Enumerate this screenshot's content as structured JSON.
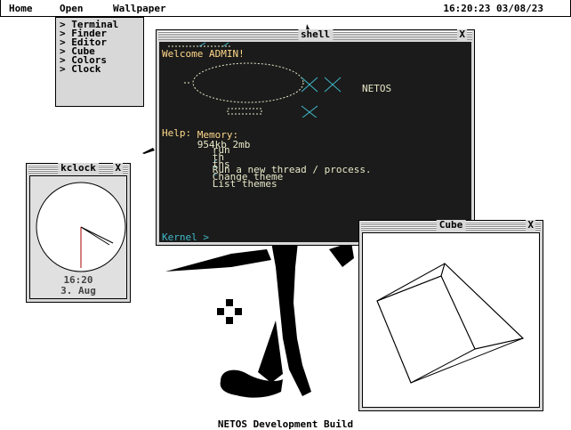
{
  "menubar": {
    "home": "Home",
    "open": "Open",
    "wallpaper": "Wallpaper",
    "clock": "16:20:23 03/08/23"
  },
  "dropdown": {
    "items": [
      {
        "label": "> Terminal"
      },
      {
        "label": "> Finder"
      },
      {
        "label": "> Editor"
      },
      {
        "label": "> Cube"
      },
      {
        "label": "> Colors"
      },
      {
        "label": "> Clock"
      }
    ]
  },
  "shell": {
    "title": "shell",
    "close": "X",
    "welcome": "Welcome ADMIN!",
    "os_name": "NETOS",
    "memory_label": "Memory:",
    "memory_value": "954kb 2mb",
    "help_label": "Help:",
    "help": [
      {
        "cmd": "run",
        "sep": "-",
        "desc": "Run a new thread / process."
      },
      {
        "cmd": "th",
        "sep": "-",
        "desc": "Change theme"
      },
      {
        "cmd": "ths",
        "sep": "-",
        "desc": "List themes"
      }
    ],
    "prompt": "Kernel >"
  },
  "kclock": {
    "title": "kclock",
    "close": "X",
    "time": "16:20",
    "date": "3. Aug"
  },
  "cube": {
    "title": "Cube",
    "close": "X"
  },
  "footer": "NETOS Development Build",
  "colors": {
    "shell_bg": "#1b1b1b",
    "accent_cyan": "#3fb8c8",
    "text_amber": "#ffd98a",
    "window_gray": "#d8d8d8"
  }
}
